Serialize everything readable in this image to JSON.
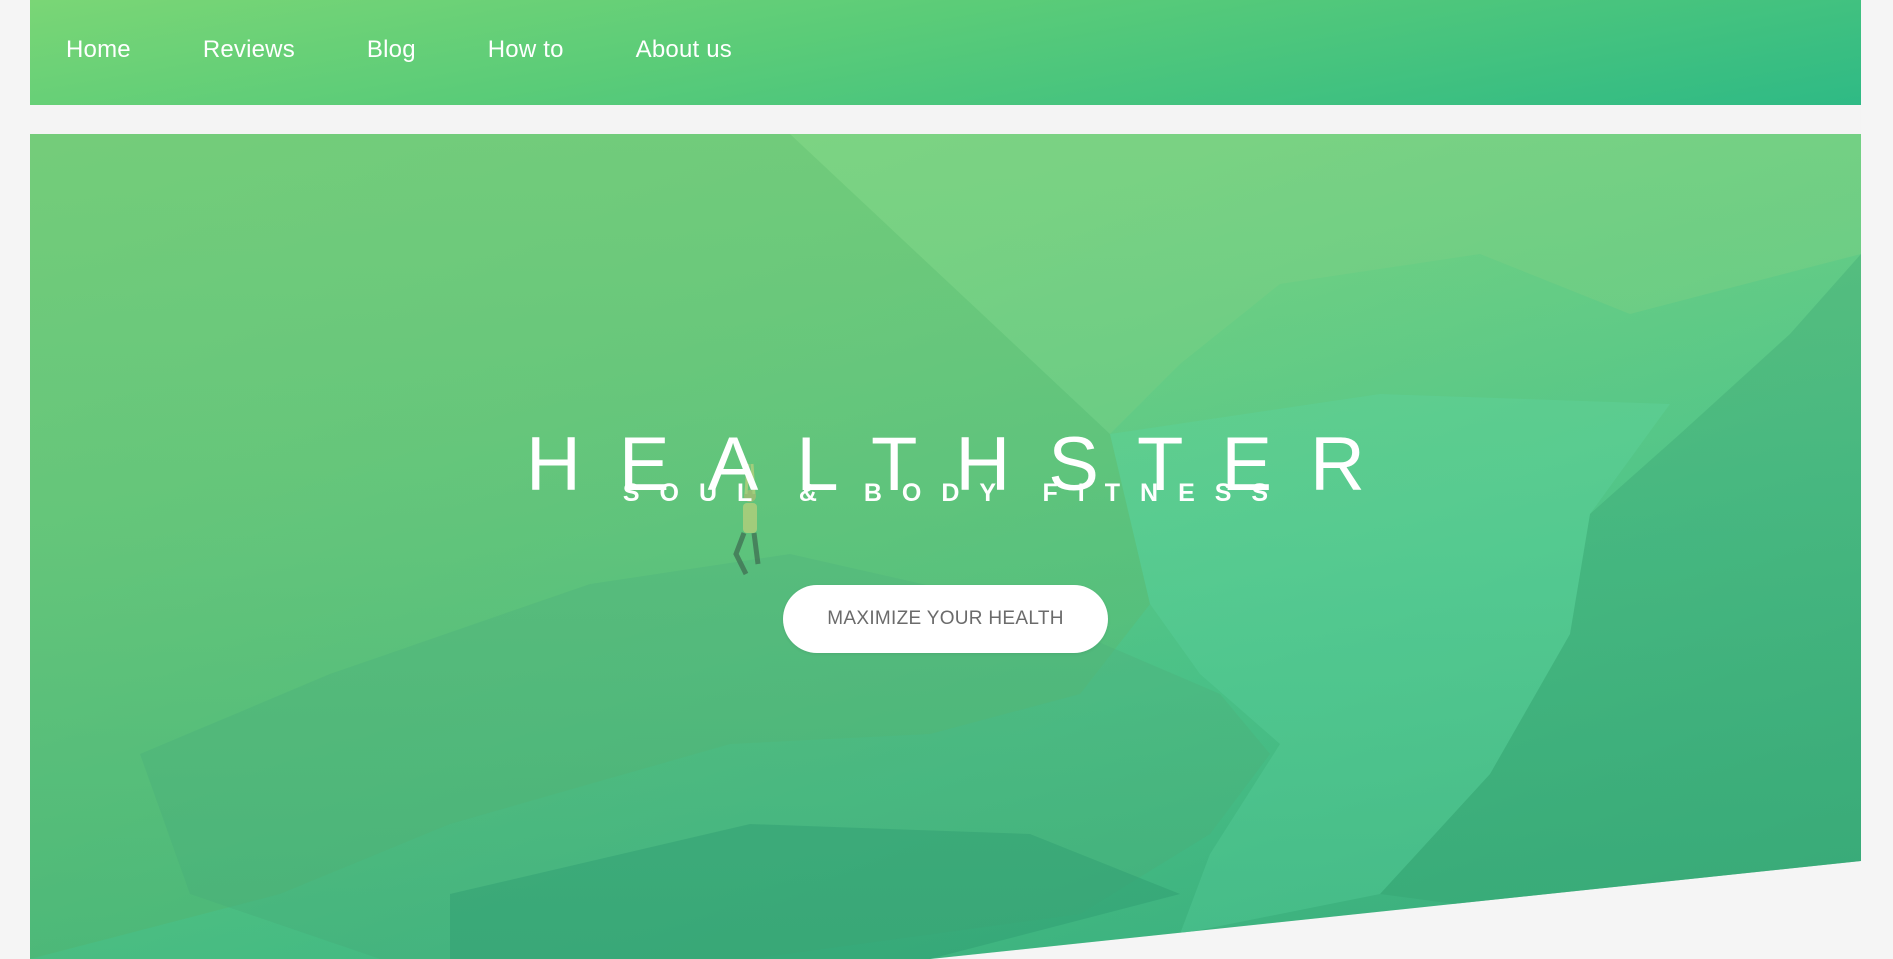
{
  "nav": {
    "items": [
      {
        "label": "Home"
      },
      {
        "label": "Reviews"
      },
      {
        "label": "Blog"
      },
      {
        "label": "How to"
      },
      {
        "label": "About us"
      }
    ]
  },
  "hero": {
    "title": "HEALTHSTER",
    "subtitle": "SOUL & BODY FITNESS",
    "cta_label": "MAXIMIZE YOUR HEALTH",
    "background_image": "mountain-fjord-yoga-photo"
  },
  "colors": {
    "nav_start": "#7ad676",
    "nav_end": "#2fba85",
    "hero_tint": "#5cc886",
    "page_bg": "#f5f5f5",
    "button_bg": "#ffffff",
    "button_text": "#6b6b6b"
  }
}
